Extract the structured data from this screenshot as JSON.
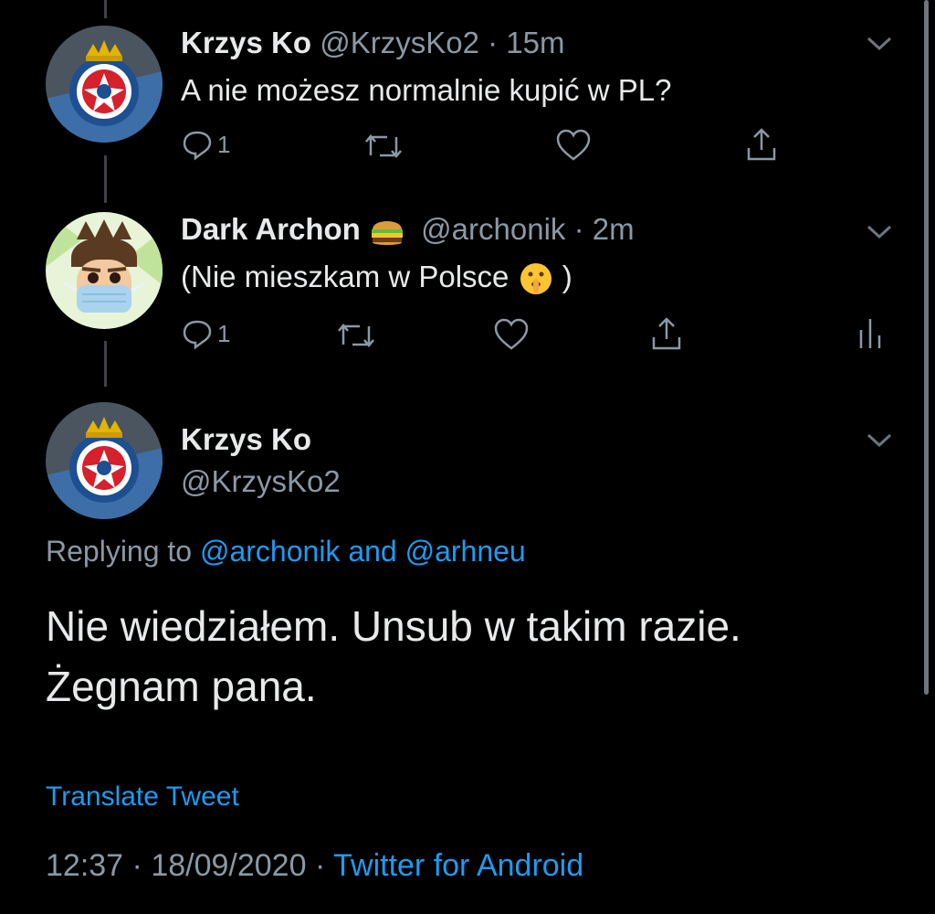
{
  "tweets": [
    {
      "name": "Krzys Ko",
      "handle": "@KrzysKo2",
      "time": "· 15m",
      "text": "A nie możesz normalnie kupić w PL?",
      "reply_count": "1",
      "avatar": "wisla-krakow-crest"
    },
    {
      "name": "Dark Archon",
      "handle": "@archonik",
      "time": "· 2m",
      "text": "(Nie mieszkam w Polsce",
      "text_end": ")",
      "reply_count": "1",
      "avatar": "masked-cartoon-man"
    }
  ],
  "main": {
    "name": "Krzys Ko",
    "handle": "@KrzysKo2",
    "replying_prefix": "Replying to",
    "replying_user1": "@archonik",
    "replying_and": "and",
    "replying_user2": "@arhneu",
    "text_line1": "Nie wiedziałem. Unsub w takim razie.",
    "text_line2": "Żegnam pana.",
    "translate": "Translate Tweet",
    "time": "12:37",
    "date": "18/09/2020",
    "source": "Twitter for Android",
    "sep": "·"
  },
  "colors": {
    "background": "#000000",
    "link": "#1d9bf0",
    "muted": "#8b98a5"
  },
  "icons": [
    "reply-icon",
    "retweet-icon",
    "like-icon",
    "share-icon",
    "analytics-icon",
    "chevron-down-icon",
    "burger-emoji",
    "shushing-face-emoji"
  ]
}
